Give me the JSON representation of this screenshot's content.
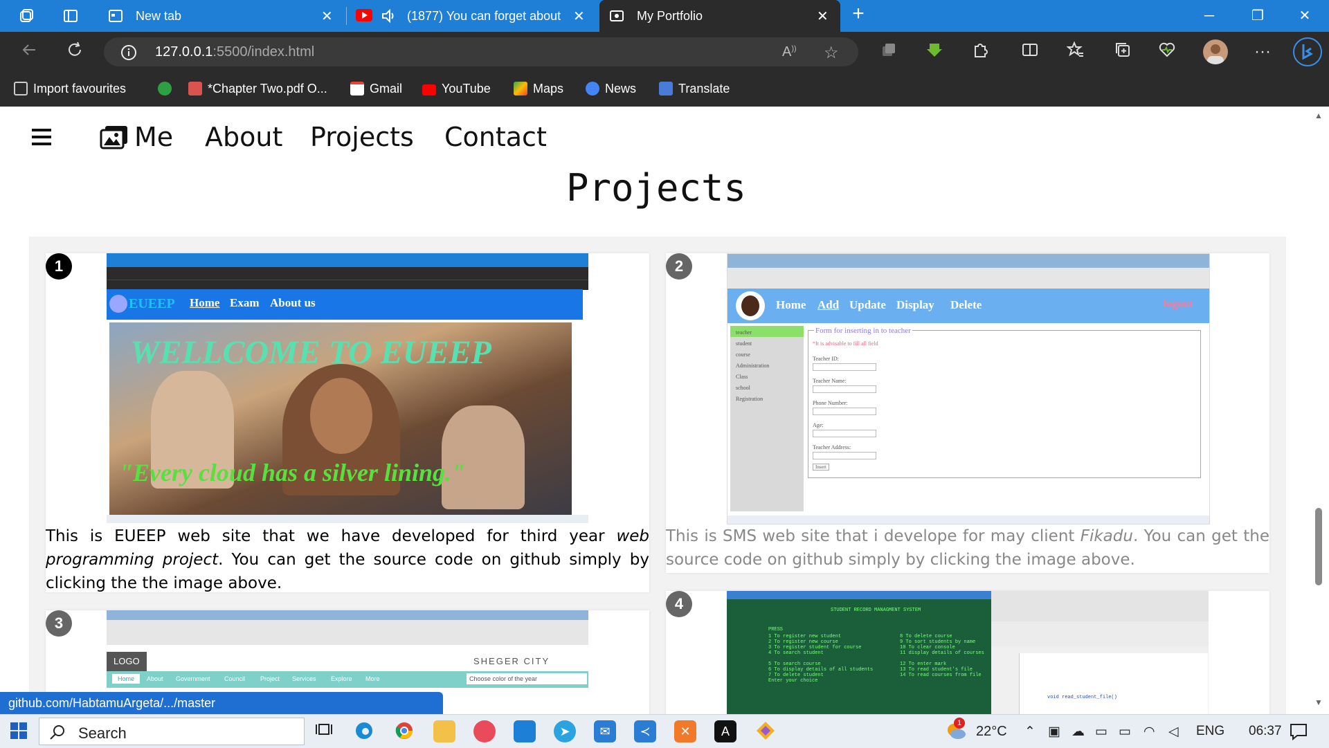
{
  "browser": {
    "tabs": [
      {
        "label": "New tab"
      },
      {
        "label": "(1877) You can forget about"
      },
      {
        "label": "My Portfolio"
      }
    ],
    "url_host": "127.0.0.1",
    "url_path": ":5500/index.html",
    "favourites": [
      {
        "label": "Import favourites",
        "color": "#cccccc"
      },
      {
        "label": "",
        "color": "#2ea043"
      },
      {
        "label": "*Chapter Two.pdf O...",
        "color": "#d9534f"
      },
      {
        "label": "Gmail",
        "color": "#ea4335"
      },
      {
        "label": "YouTube",
        "color": "#ff0000"
      },
      {
        "label": "Maps",
        "color": "#34a853"
      },
      {
        "label": "News",
        "color": "#4285f4"
      },
      {
        "label": "Translate",
        "color": "#4a7bd6"
      }
    ]
  },
  "site": {
    "nav": {
      "brand": "Me",
      "about": "About",
      "projects": "Projects",
      "contact": "Contact"
    },
    "section_title": "Projects",
    "cards": [
      {
        "num": "1",
        "text_a": "This is EUEEP web site that we have developed for third year ",
        "text_em": "web programming project",
        "text_b": ". You can get the source code on github simply by clicking the the image above.",
        "shot": {
          "brand": "EUEEP",
          "nav": [
            "Home",
            "Exam",
            "About us"
          ],
          "headline": "WELLCOME TO EUEEP",
          "quote": "\"Every cloud has a silver lining.\""
        }
      },
      {
        "num": "2",
        "text_a": "This is SMS web site that i develope for may client ",
        "text_em": "Fikadu",
        "text_b": ". You can get the source code on github simply by clicking the image above.",
        "shot": {
          "nav": [
            "Home",
            "Add",
            "Update",
            "Display",
            "Delete"
          ],
          "logout": "logout",
          "sidebar": [
            "teacher",
            "student",
            "course",
            "Administration",
            "Class",
            "school",
            "Registration"
          ],
          "form_title": "Form for inserting in to teacher",
          "form_note": "*It is advisable to fill all field",
          "fields": [
            "Teacher ID:",
            "Teacher Name:",
            "Phone Number:",
            "Age:",
            "Teacher Address:"
          ],
          "submit": "Insert"
        }
      },
      {
        "num": "3",
        "shot": {
          "logo": "LOGO",
          "city": "SHEGER CITY",
          "nav": [
            "Home",
            "About",
            "Government",
            "Council",
            "Project",
            "Services",
            "Explore",
            "More"
          ],
          "select": "Choose color of the year"
        }
      },
      {
        "num": "4",
        "shot": {
          "title": "STUDENT RECORD MANAGMENT SYSTEM",
          "press": "PRESS",
          "menu_left": [
            "1  To register new student",
            "2  To register new course",
            "3  To register student for course",
            "4  To search student",
            "5  To search course",
            "6  To display details of all students",
            "7  To delete student",
            "   Enter your choice"
          ],
          "menu_right": [
            "8  To delete course",
            "9  To sort students by name",
            "10  To clear console",
            "11  display details of courses",
            "12  To enter mark",
            "13  To read student's file",
            "14  To read courses from file"
          ],
          "code_line": "void read_student_file()"
        }
      }
    ],
    "status_link": "github.com/HabtamuArgeta/.../master"
  },
  "taskbar": {
    "search": "Search",
    "weather": "22°C",
    "weather_badge": "1",
    "lang": "ENG",
    "time": "06:37"
  },
  "colors": {
    "titlebar": "#1f7ed6",
    "chrome": "#2b2b2b",
    "status": "#1f6fd2",
    "eueep_nav": "#1976e6",
    "sms_nav": "#6ab0f0"
  }
}
